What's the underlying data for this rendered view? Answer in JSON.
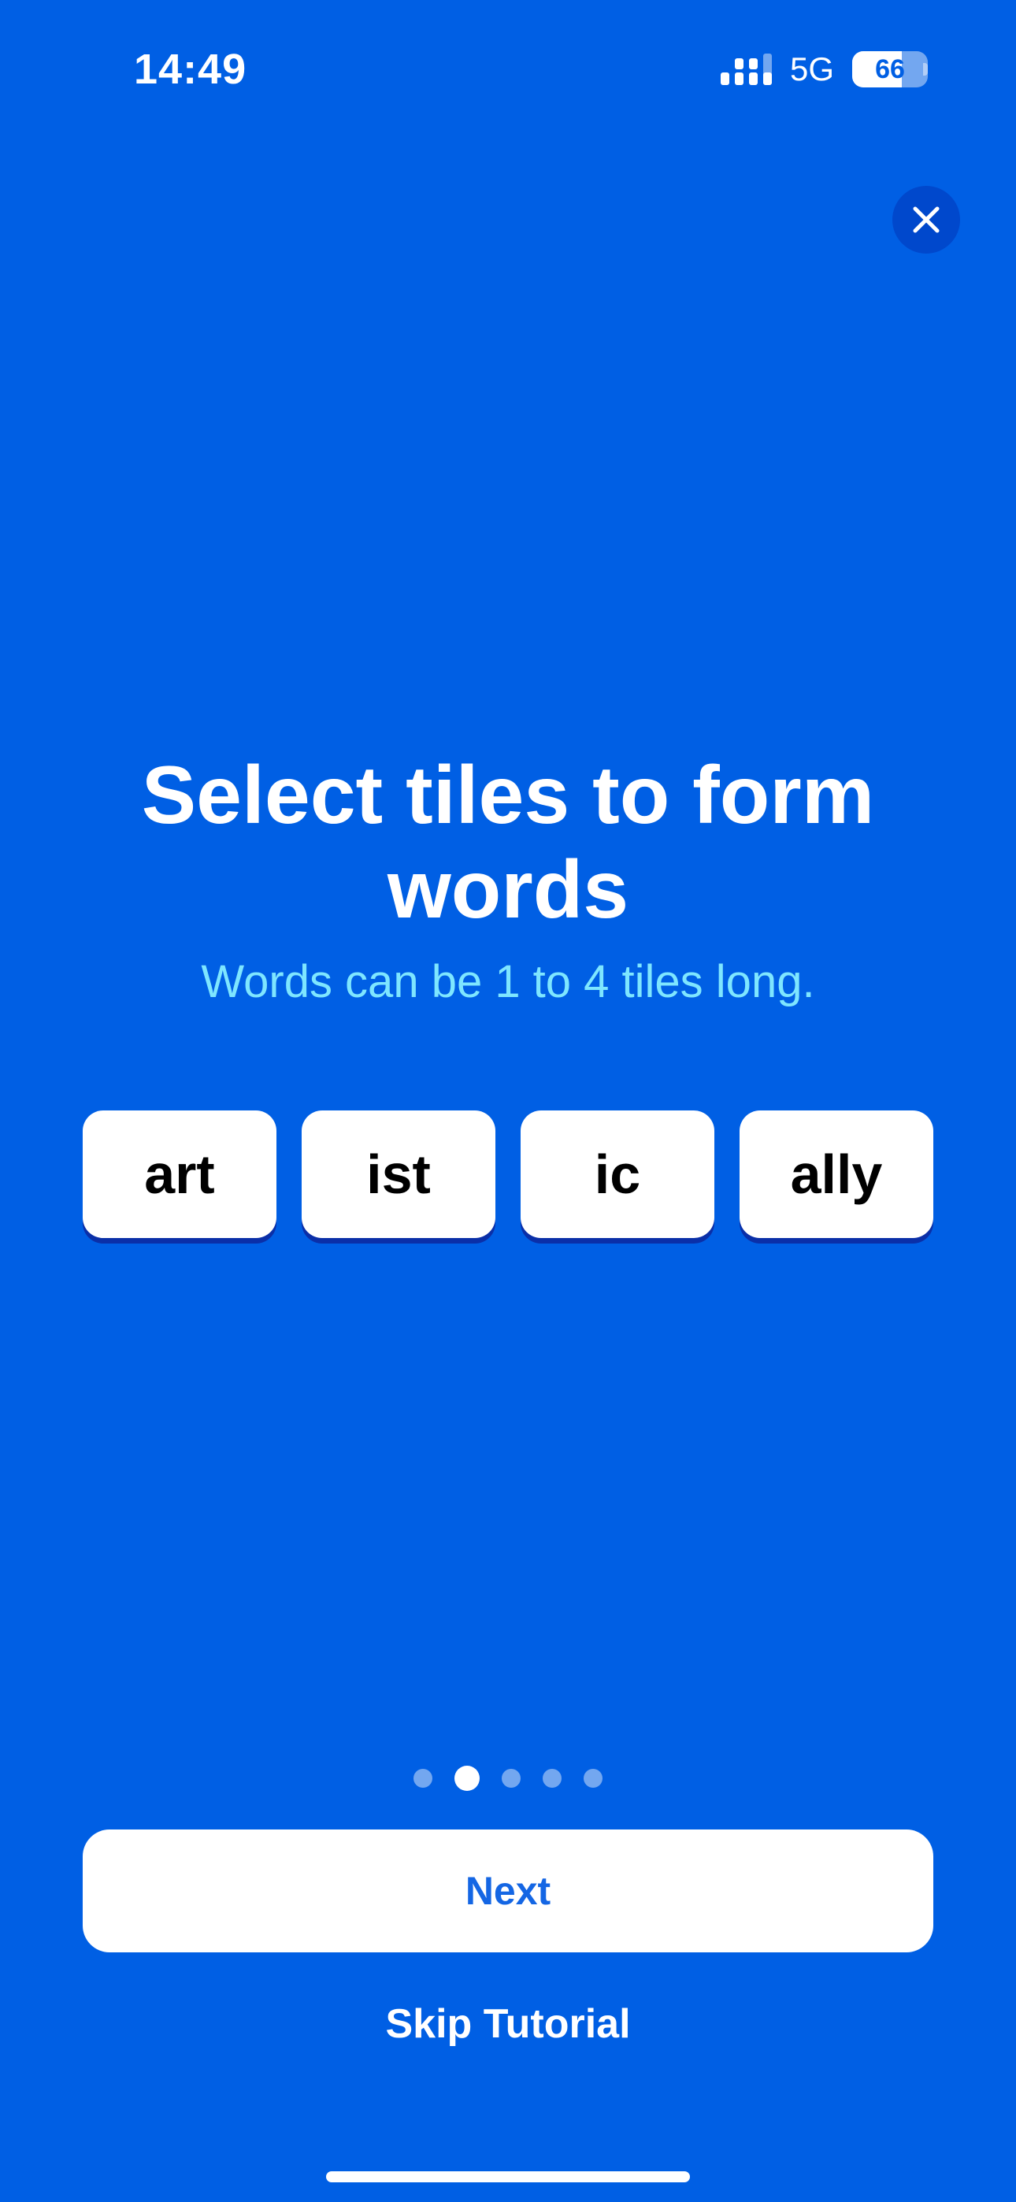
{
  "status_bar": {
    "time": "14:49",
    "network": "5G",
    "battery_level": "66",
    "battery_fraction": 0.66,
    "icons": [
      "signal-bars-icon",
      "battery-icon"
    ]
  },
  "close_button": {
    "icon": "close-icon"
  },
  "tutorial": {
    "title": "Select tiles to form words",
    "subtitle": "Words can be 1 to 4 tiles long.",
    "tiles": [
      "art",
      "ist",
      "ic",
      "ally"
    ]
  },
  "pagination": {
    "total_pages": 5,
    "current_page": 2
  },
  "actions": {
    "next_label": "Next",
    "skip_label": "Skip Tutorial"
  },
  "colors": {
    "background": "#005FE4",
    "subtitle": "#7EE6FF",
    "button_text": "#1466E4",
    "tile_shadow": "#0A2FA8"
  }
}
